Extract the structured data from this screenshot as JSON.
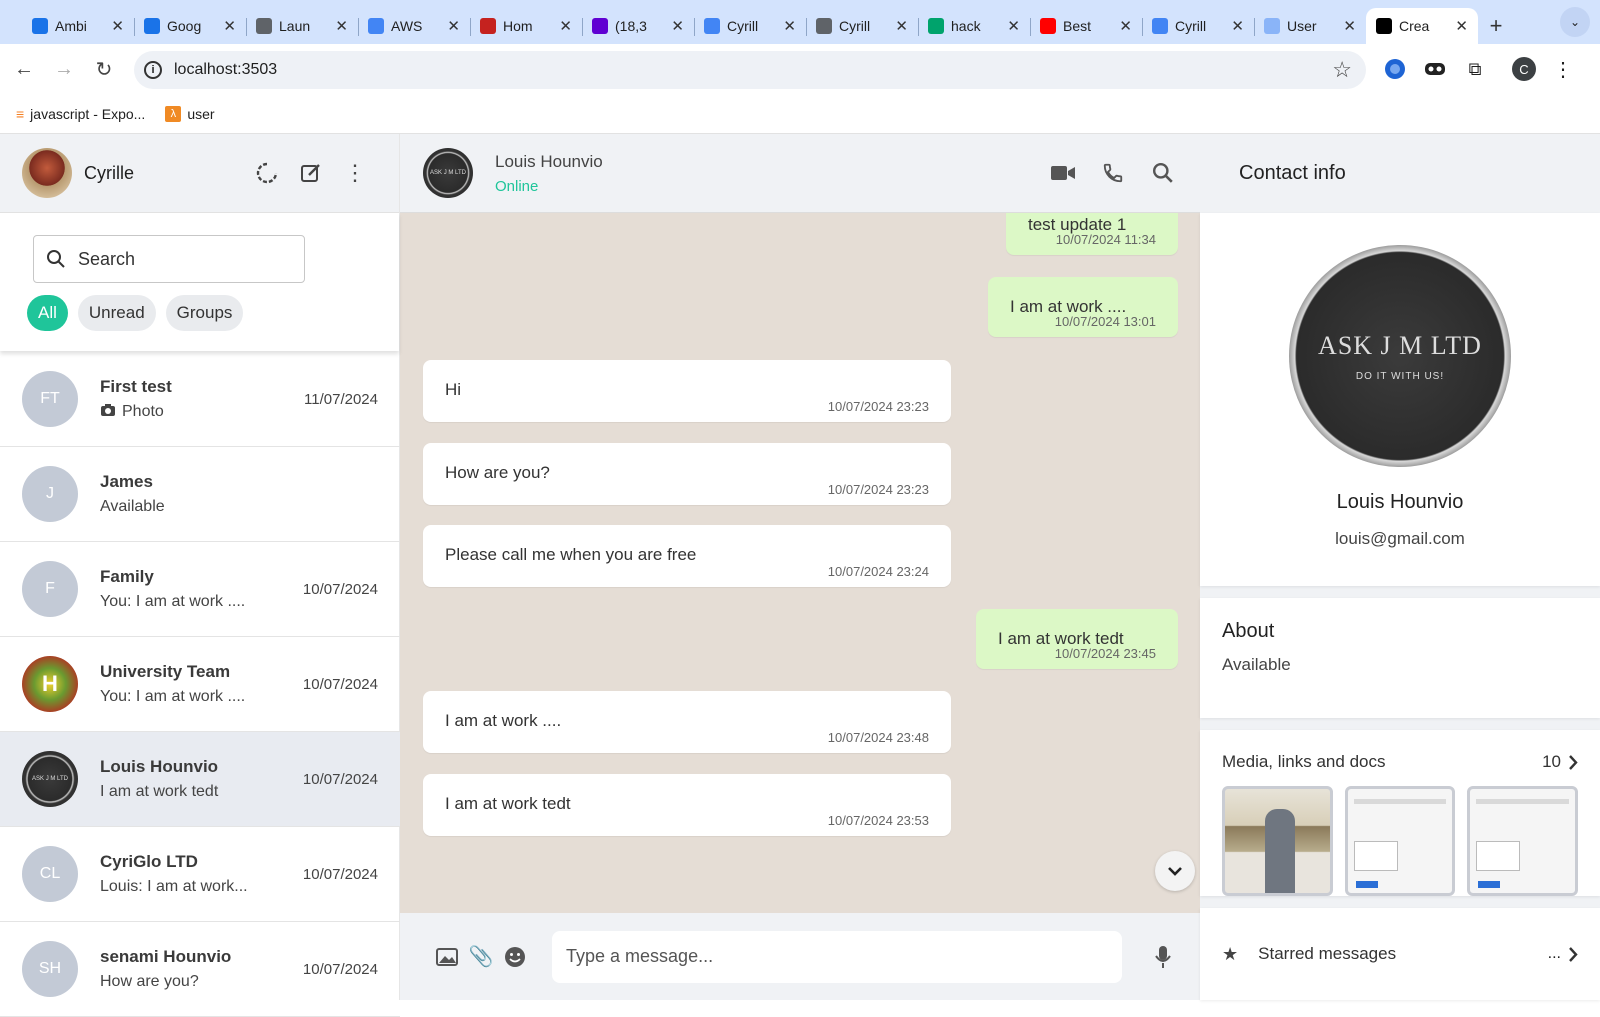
{
  "browser": {
    "tabs": [
      {
        "title": "Ambi",
        "icon": "google-calendar-icon",
        "color": "#1a73e8"
      },
      {
        "title": "Goog",
        "icon": "google-calendar-icon",
        "color": "#1a73e8"
      },
      {
        "title": "Laun",
        "icon": "globe-icon",
        "color": "#5f6368"
      },
      {
        "title": "AWS",
        "icon": "google-docs-icon",
        "color": "#4285f4"
      },
      {
        "title": "Hom",
        "icon": "document-icon",
        "color": "#c5221f"
      },
      {
        "title": "(18,3",
        "icon": "mail-icon",
        "color": "#6001d2"
      },
      {
        "title": "Cyrill",
        "icon": "google-docs-icon",
        "color": "#4285f4"
      },
      {
        "title": "Cyrill",
        "icon": "globe-icon",
        "color": "#5f6368"
      },
      {
        "title": "hack",
        "icon": "infinity-icon",
        "color": "#00a36c"
      },
      {
        "title": "Best",
        "icon": "youtube-icon",
        "color": "#ff0000"
      },
      {
        "title": "Cyrill",
        "icon": "google-docs-icon",
        "color": "#4285f4"
      },
      {
        "title": "User",
        "icon": "globe-icon",
        "color": "#8ab4f8"
      },
      {
        "title": "Crea",
        "icon": "triangle-logo-icon",
        "color": "#000000"
      }
    ],
    "url": "localhost:3503",
    "profile_initial": "C",
    "bookmarks": [
      {
        "label": "javascript - Expo...",
        "icon": "stackoverflow-icon"
      },
      {
        "label": "user",
        "icon": "aws-icon"
      }
    ]
  },
  "sidebar": {
    "user_name": "Cyrille",
    "search_placeholder": "Search",
    "filters": [
      "All",
      "Unread",
      "Groups"
    ],
    "chats": [
      {
        "initials": "FT",
        "name": "First test",
        "message": "Photo",
        "date": "11/07/2024",
        "avatar": "initials",
        "photo": true
      },
      {
        "initials": "J",
        "name": "James",
        "message": "Available",
        "date": "",
        "avatar": "initials"
      },
      {
        "initials": "F",
        "name": "Family",
        "message": "You: I am at work ....",
        "date": "10/07/2024",
        "avatar": "initials"
      },
      {
        "initials": "H",
        "name": "University Team",
        "message": "You: I am at work ....",
        "date": "10/07/2024",
        "avatar": "uni"
      },
      {
        "initials": "ASK J M LTD",
        "name": "Louis Hounvio",
        "message": "I am at work tedt",
        "date": "10/07/2024",
        "avatar": "logo",
        "selected": true
      },
      {
        "initials": "CL",
        "name": "CyriGlo LTD",
        "message": "Louis: I am at work...",
        "date": "10/07/2024",
        "avatar": "initials"
      },
      {
        "initials": "SH",
        "name": "senami Hounvio",
        "message": "How are you?",
        "date": "10/07/2024",
        "avatar": "initials"
      }
    ]
  },
  "chat": {
    "contact_name": "Louis Hounvio",
    "status": "Online",
    "messages": [
      {
        "text": "test update 1",
        "time": "10/07/2024 11:34",
        "dir": "out"
      },
      {
        "text": "I am at work ....",
        "time": "10/07/2024 13:01",
        "dir": "out"
      },
      {
        "text": "Hi",
        "time": "10/07/2024 23:23",
        "dir": "in"
      },
      {
        "text": "How are you?",
        "time": "10/07/2024 23:23",
        "dir": "in"
      },
      {
        "text": "Please call me when you are free",
        "time": "10/07/2024 23:24",
        "dir": "in"
      },
      {
        "text": "I am at work tedt",
        "time": "10/07/2024 23:45",
        "dir": "out"
      },
      {
        "text": "I am at work ....",
        "time": "10/07/2024 23:48",
        "dir": "in"
      },
      {
        "text": "I am at work tedt",
        "time": "10/07/2024 23:53",
        "dir": "in"
      }
    ],
    "compose_placeholder": "Type a message..."
  },
  "contact_info": {
    "title": "Contact info",
    "logo_line1": "ASK J M LTD",
    "logo_line2": "DO IT WITH US!",
    "name": "Louis Hounvio",
    "email": "louis@gmail.com",
    "about_title": "About",
    "about_text": "Available",
    "media_title": "Media, links and docs",
    "media_count": "10",
    "starred_label": "Starred messages",
    "starred_more": "..."
  }
}
